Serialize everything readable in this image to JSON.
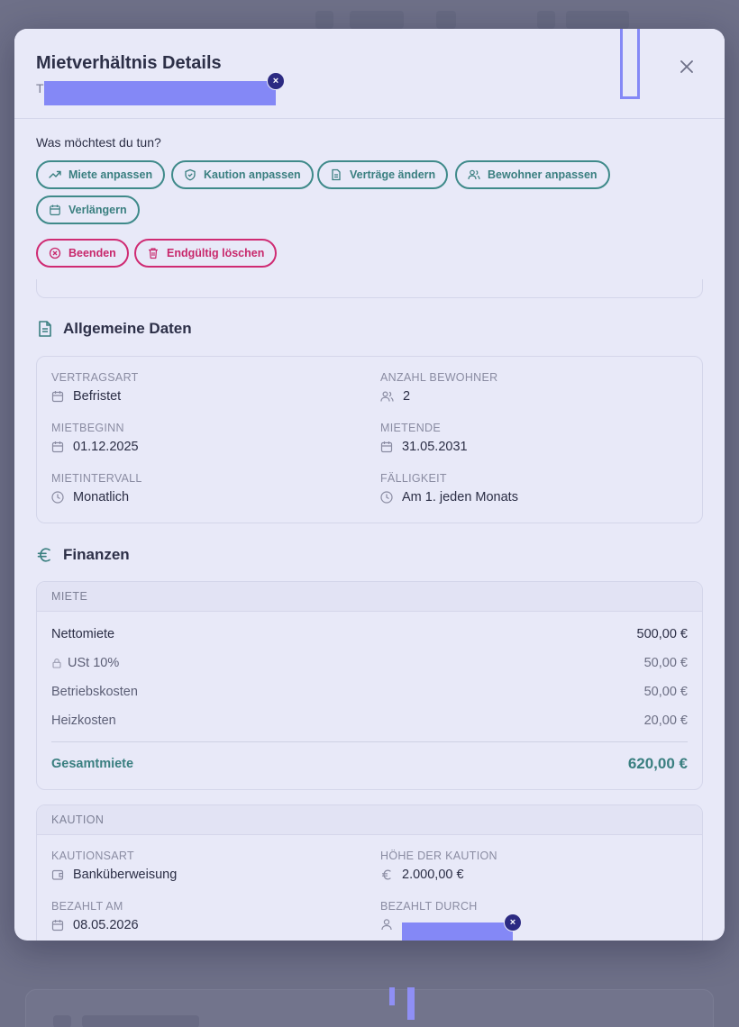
{
  "modal": {
    "title": "Mietverhältnis Details",
    "subtitle_visible": "T"
  },
  "actions": {
    "prompt": "Was möchtest du tun?",
    "buttons": [
      {
        "label": "Miete anpassen",
        "icon": "trending-up-icon"
      },
      {
        "label": "Kaution anpassen",
        "icon": "shield-icon"
      },
      {
        "label": "Verträge ändern",
        "icon": "document-icon"
      },
      {
        "label": "Bewohner anpassen",
        "icon": "users-icon"
      },
      {
        "label": "Verlängern",
        "icon": "calendar-icon"
      }
    ],
    "danger_buttons": [
      {
        "label": "Beenden",
        "icon": "x-circle-icon"
      },
      {
        "label": "Endgültig löschen",
        "icon": "trash-icon"
      }
    ]
  },
  "general": {
    "title": "Allgemeine Daten",
    "fields": [
      {
        "label": "VERTRAGSART",
        "value": "Befristet",
        "icon": "calendar-icon"
      },
      {
        "label": "ANZAHL BEWOHNER",
        "value": "2",
        "icon": "users-icon"
      },
      {
        "label": "MIETBEGINN",
        "value": "01.12.2025",
        "icon": "calendar-icon"
      },
      {
        "label": "MIETENDE",
        "value": "31.05.2031",
        "icon": "calendar-icon"
      },
      {
        "label": "MIETINTERVALL",
        "value": "Monatlich",
        "icon": "clock-icon"
      },
      {
        "label": "FÄLLIGKEIT",
        "value": "Am 1. jeden Monats",
        "icon": "clock-icon"
      }
    ]
  },
  "finances": {
    "title": "Finanzen",
    "rent": {
      "header": "MIETE",
      "rows": [
        {
          "label": "Nettomiete",
          "value": "500,00 €"
        },
        {
          "label": "USt 10%",
          "value": "50,00 €"
        },
        {
          "label": "Betriebskosten",
          "value": "50,00 €"
        },
        {
          "label": "Heizkosten",
          "value": "20,00 €"
        }
      ],
      "total_label": "Gesamtmiete",
      "total_value": "620,00 €"
    },
    "deposit": {
      "header": "KAUTION",
      "fields": [
        {
          "label": "KAUTIONSART",
          "value": "Banküberweisung",
          "icon": "wallet-icon"
        },
        {
          "label": "HÖHE DER KAUTION",
          "value": "2.000,00 €",
          "icon": "euro-icon"
        },
        {
          "label": "BEZAHLT AM",
          "value": "08.05.2026",
          "icon": "calendar-icon"
        },
        {
          "label": "BEZAHLT DURCH",
          "value": "",
          "icon": "user-icon"
        }
      ]
    }
  },
  "colors": {
    "accent": "#3a7f80",
    "danger": "#c8276b",
    "modal_bg": "#e8e9f8",
    "redaction": "#8488f6"
  }
}
